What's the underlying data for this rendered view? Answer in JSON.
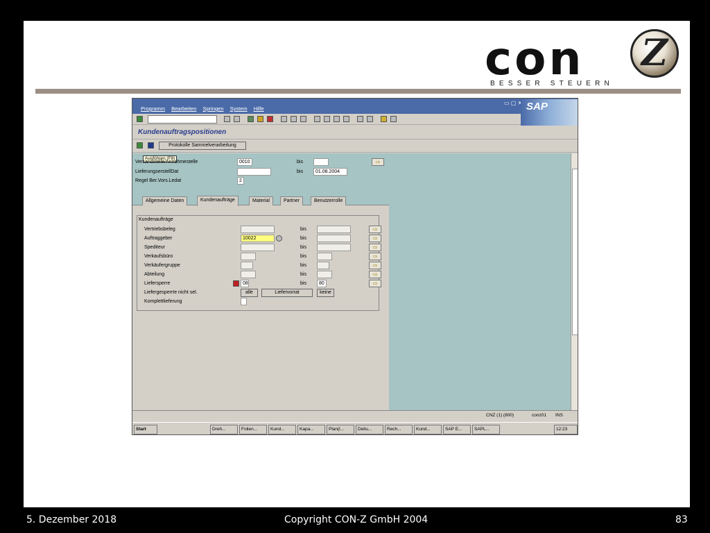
{
  "slide": {
    "logo_text": "con",
    "logo_mark": "Z",
    "logo_tagline": "BESSER STEUERN",
    "footer_date": "5. Dezember 2018",
    "footer_copyright": "Copyright CON-Z GmbH 2004",
    "footer_page": "83"
  },
  "sap": {
    "menu": [
      "Programm",
      "Bearbeiten",
      "Springen",
      "System",
      "Hilfe"
    ],
    "brand": "SAP",
    "title": "Kundenauftragspositionen",
    "toolbar": {
      "protokolle_label": "Protokolle Sammelverarbeitung"
    },
    "tooltip": "Ausführen  (F8)",
    "header_fields": [
      {
        "label": "Versandstelle/Annahmestelle",
        "value": "0010",
        "bis_label": "bis",
        "bis_value": ""
      },
      {
        "label": "LieferungserstellDat",
        "value": "",
        "bis_label": "bis",
        "bis_value": "01.08.2004"
      },
      {
        "label": "Regel Ber.Vors.Ledat",
        "value": "2"
      }
    ],
    "tabs": [
      "Allgemeine Daten",
      "Kundenaufträge",
      "Material",
      "Partner",
      "Benutzerrolle"
    ],
    "group_title": "Kundenaufträge",
    "rows": [
      {
        "label": "Vertriebsbeleg",
        "value": "",
        "bis": "bis",
        "bis_value": ""
      },
      {
        "label": "Auftraggeber",
        "value": "10022",
        "bis": "bis",
        "bis_value": ""
      },
      {
        "label": "Spediteur",
        "value": "",
        "bis": "bis",
        "bis_value": ""
      },
      {
        "label": "Verkaufsbüro",
        "value": "",
        "bis": "bis",
        "bis_value": ""
      },
      {
        "label": "Verkäufergruppe",
        "value": "",
        "bis": "bis",
        "bis_value": ""
      },
      {
        "label": "Abteilung",
        "value": "",
        "bis": "bis",
        "bis_value": ""
      },
      {
        "label": "Liefersperre",
        "value": "08",
        "bis": "bis",
        "bis_value": "80"
      }
    ],
    "liefersperre_nicht_sel": {
      "label": "Liefergesperrte nicht sel.",
      "alle": "alle",
      "liefervorrat": "Liefervorrat",
      "keine": "keine"
    },
    "komplettlieferung": {
      "label": "Komplettlieferung"
    },
    "status": {
      "system": "CNZ (1) (800)",
      "user": "conz01",
      "mode": "INS"
    },
    "taskbar": {
      "start": "Start",
      "tasks": [
        "Dreh...",
        "Folien...",
        "Kund...",
        "Kapa...",
        "Plan(l...",
        "Deliu...",
        "Rech...",
        "Kund...",
        "SAP E...",
        "SAPL..."
      ],
      "clock": "12:23"
    }
  }
}
